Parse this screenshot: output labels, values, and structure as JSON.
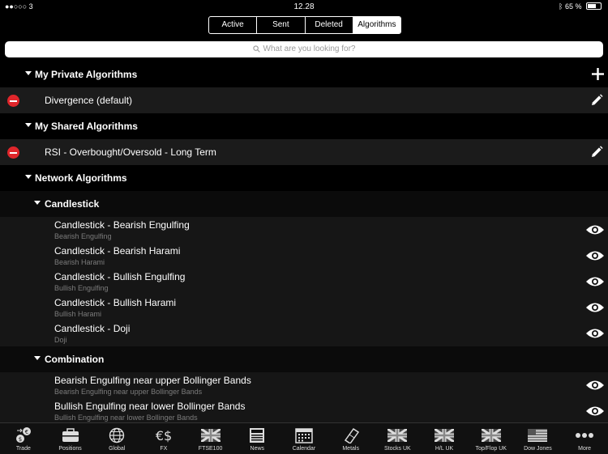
{
  "status_bar": {
    "carrier": "●●○○○ 3",
    "time": "12.28",
    "battery": "65 %"
  },
  "segments": [
    {
      "label": "Active",
      "selected": false
    },
    {
      "label": "Sent",
      "selected": false
    },
    {
      "label": "Deleted",
      "selected": false
    },
    {
      "label": "Algorithms",
      "selected": true
    }
  ],
  "search": {
    "placeholder": "What are you looking for?"
  },
  "sections": {
    "private": {
      "title": "My Private Algorithms",
      "items": [
        "Divergence (default)"
      ]
    },
    "shared": {
      "title": "My Shared Algorithms",
      "items": [
        "RSI - Overbought/Oversold - Long Term"
      ]
    },
    "network": {
      "title": "Network Algorithms",
      "groups": [
        {
          "title": "Candlestick",
          "items": [
            {
              "title": "Candlestick - Bearish Engulfing",
              "subtitle": "Bearish Engulfing"
            },
            {
              "title": "Candlestick - Bearish Harami",
              "subtitle": "Bearish Harami"
            },
            {
              "title": "Candlestick - Bullish Engulfing",
              "subtitle": "Bullish Engulfing"
            },
            {
              "title": "Candlestick - Bullish Harami",
              "subtitle": "Bullish Harami"
            },
            {
              "title": "Candlestick - Doji",
              "subtitle": "Doji"
            }
          ]
        },
        {
          "title": "Combination",
          "items": [
            {
              "title": "Bearish Engulfing near upper Bollinger Bands",
              "subtitle": "Bearish Engulfing near upper Bollinger Bands"
            },
            {
              "title": "Bullish Engulfing near lower Bollinger Bands",
              "subtitle": "Bullish Engulfing near lower Bollinger Bands"
            }
          ]
        }
      ]
    }
  },
  "tabbar": [
    {
      "label": "Trade",
      "icon": "trade-icon"
    },
    {
      "label": "Positions",
      "icon": "positions-icon"
    },
    {
      "label": "Global",
      "icon": "globe-icon"
    },
    {
      "label": "FX",
      "icon": "fx-icon"
    },
    {
      "label": "FTSE100",
      "icon": "uk-flag-icon"
    },
    {
      "label": "News",
      "icon": "news-icon"
    },
    {
      "label": "Calendar",
      "icon": "calendar-icon"
    },
    {
      "label": "Metals",
      "icon": "metals-icon"
    },
    {
      "label": "Stocks UK",
      "icon": "uk-flag-icon"
    },
    {
      "label": "H/L UK",
      "icon": "uk-flag-icon"
    },
    {
      "label": "Top/Flop UK",
      "icon": "uk-flag-icon"
    },
    {
      "label": "Dow Jones",
      "icon": "us-flag-icon"
    },
    {
      "label": "More",
      "icon": "more-icon"
    }
  ]
}
